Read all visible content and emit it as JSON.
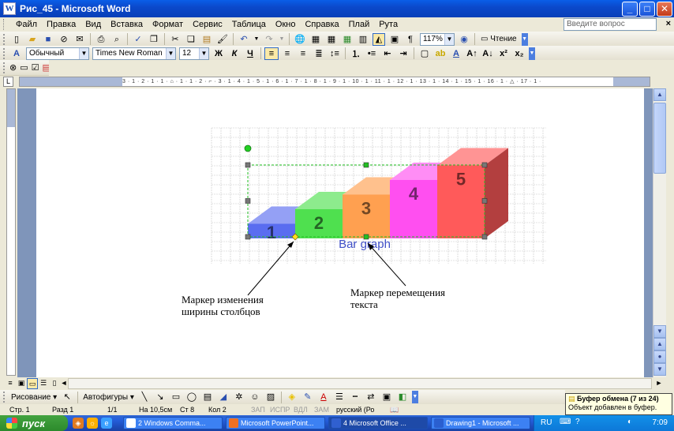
{
  "window": {
    "title": "Рис_45 - Microsoft Word",
    "app_icon_letter": "W"
  },
  "menu": {
    "items": [
      "Файл",
      "Правка",
      "Вид",
      "Вставка",
      "Формат",
      "Сервис",
      "Таблица",
      "Окно",
      "Справка",
      "Плай",
      "Рута"
    ],
    "help_placeholder": "Введите вопрос"
  },
  "standard_toolbar": {
    "zoom": "117%",
    "read_label": "Чтение"
  },
  "formatting_toolbar": {
    "style": "Обычный",
    "font": "Times New Roman",
    "size": "12",
    "bold": "Ж",
    "italic": "К",
    "underline": "Ч"
  },
  "ruler": {
    "ticks": "3 · 1 · 2 · 1 · 1 · ⌂ · 1 · 1 · 2 · ⌐ · 3 · 1 · 4 · 1 · 5 · 1 · 6 · 1 · 7 · 1 · 8 · 1 · 9 · 1 · 10 · 1 · 11 · 1 · 12 · 1 · 13 · 1 · 14 · 1 · 15 · 1 · 16 · 1 · △ · 17 · 1 ·"
  },
  "chart_data": {
    "type": "bar",
    "categories": [
      "1",
      "2",
      "3",
      "4",
      "5"
    ],
    "values": [
      1,
      2,
      3,
      4,
      5
    ],
    "title": "Bar graph",
    "colors": [
      "#5a6df0",
      "#4fe04f",
      "#ffa050",
      "#ff4ff0",
      "#ff5a5a"
    ],
    "ylim": [
      0,
      5
    ]
  },
  "callouts": {
    "resize_marker": [
      "Маркер изменения",
      "ширины столбцов"
    ],
    "move_text_marker": [
      "Маркер перемещения",
      "текста"
    ]
  },
  "draw_toolbar": {
    "drawing": "Рисование",
    "autoshapes": "Автофигуры"
  },
  "status": {
    "page": "Стр. 1",
    "section": "Разд 1",
    "pages": "1/1",
    "position": "На 10,5см",
    "line": "Ст 8",
    "column": "Кол 2",
    "rec": "ЗАП",
    "trk": "ИСПР",
    "ext": "ВДЛ",
    "ovr": "ЗАМ",
    "lang": "русский (Ро"
  },
  "clipboard": {
    "title": "Буфер обмена (7 из 24)",
    "message": "Объект добавлен в буфер."
  },
  "taskbar": {
    "start": "пуск",
    "tasks": [
      "2 Windows Comma...",
      "Microsoft PowerPoint...",
      "4 Microsoft Office ...",
      "Drawing1 - Microsoft ..."
    ],
    "lang": "RU",
    "clock": "7:09"
  }
}
